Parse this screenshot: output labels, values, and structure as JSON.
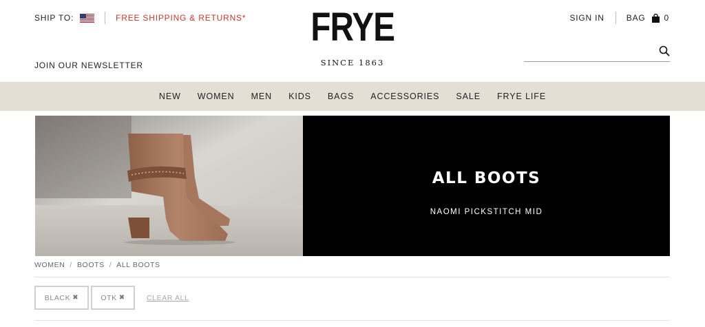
{
  "header": {
    "ship_to_label": "SHIP TO:",
    "ship_to_flag": "us-flag-icon",
    "promo": "FREE SHIPPING & RETURNS*",
    "promo_color": "#c0392b",
    "newsletter": "JOIN OUR NEWSLETTER",
    "logo": {
      "word": "FRYE",
      "tagline": "SINCE 1863"
    },
    "sign_in": "SIGN IN",
    "bag_label": "BAG",
    "bag_icon": "shopping-bag-icon",
    "bag_count": "0",
    "search": {
      "placeholder": "",
      "icon": "search-icon"
    }
  },
  "nav": {
    "background": "#e3dfd5",
    "items": [
      "NEW",
      "WOMEN",
      "MEN",
      "KIDS",
      "BAGS",
      "ACCESSORIES",
      "SALE",
      "FRYE LIFE"
    ]
  },
  "hero": {
    "title": "ALL BOOTS",
    "subtitle": "NAOMI PICKSTITCH MID",
    "panel_color": "#000000"
  },
  "breadcrumb": [
    "WOMEN",
    "BOOTS",
    "ALL BOOTS"
  ],
  "filters": {
    "chips": [
      {
        "label": "BLACK",
        "remove_icon": "close-icon"
      },
      {
        "label": "OTK",
        "remove_icon": "close-icon"
      }
    ],
    "clear_all": "CLEAR ALL"
  }
}
